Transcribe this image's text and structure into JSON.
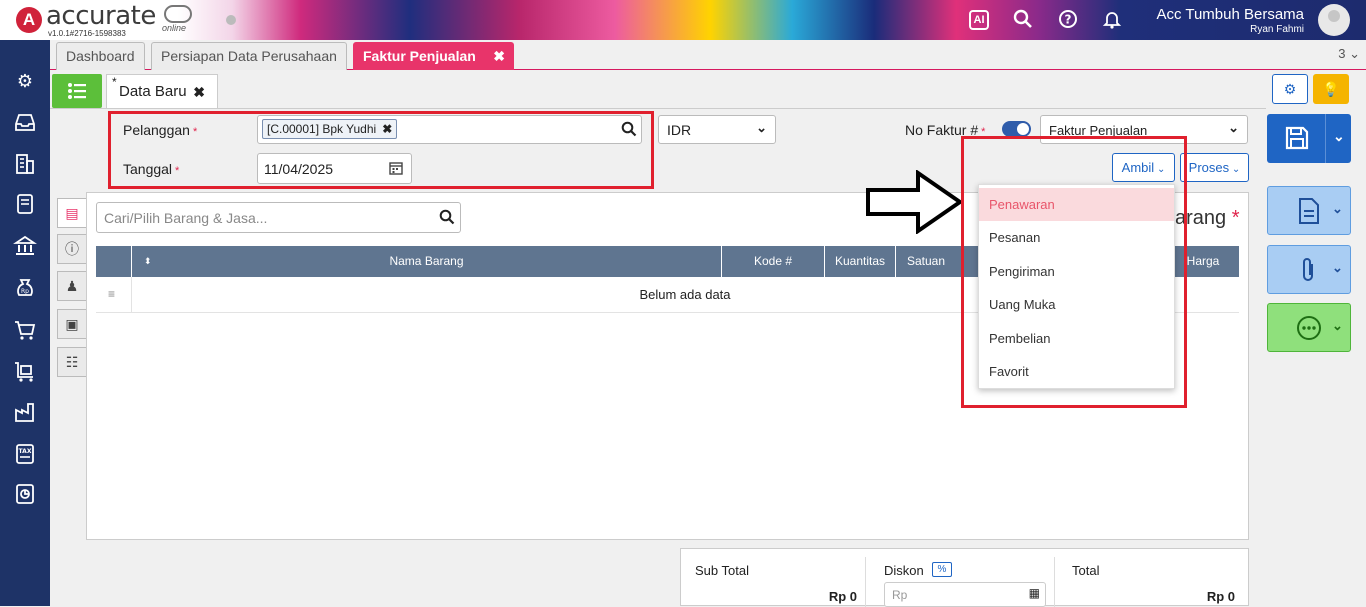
{
  "app": {
    "logo_text": "accurate",
    "logo_sub": "online",
    "version": "v1.0.1#2716-1598383",
    "company": "Acc Tumbuh Bersama",
    "user": "Ryan Fahmi"
  },
  "header_icons": [
    "ai-chip-icon",
    "search-icon",
    "help-icon",
    "bell-icon"
  ],
  "tabs": [
    {
      "label": "Dashboard"
    },
    {
      "label": "Persiapan Data Perusahaan"
    },
    {
      "label": "Faktur Penjualan",
      "close": "✖"
    }
  ],
  "tab_count": "3 ⌄",
  "subtab": {
    "label": "Data Baru",
    "modified": "*",
    "close": "✖"
  },
  "form": {
    "pelanggan_label": "Pelanggan",
    "pelanggan_value": "[C.00001] Bpk Yudhi",
    "tanggal_label": "Tanggal",
    "tanggal_value": "11/04/2025",
    "required_mark": "*",
    "currency": "IDR",
    "no_faktur_label": "No Faktur #",
    "faktur_type": "Faktur Penjualan",
    "ambil_label": "Ambil",
    "proses_label": "Proses"
  },
  "items": {
    "search_placeholder": "Cari/Pilih Barang & Jasa...",
    "title_fragment": "arang",
    "columns": [
      "Nama Barang",
      "Kode #",
      "Kuantitas",
      "Satuan",
      "Harga"
    ],
    "empty_text": "Belum ada data"
  },
  "ambil_menu": {
    "items": [
      "Penawaran",
      "Pesanan",
      "Pengiriman",
      "Uang Muka",
      "Pembelian",
      "Favorit"
    ],
    "selected": "Penawaran"
  },
  "totals": {
    "subtotal_label": "Sub Total",
    "subtotal_value": "Rp 0",
    "diskon_label": "Diskon",
    "diskon_unit": "%",
    "diskon_placeholder": "Rp",
    "total_label": "Total",
    "total_value": "Rp 0"
  },
  "colors": {
    "sidebar": "#1e3367",
    "accent_tab": "#e8346a",
    "save_button": "#1f65c4",
    "highlight_box": "#e0202e"
  }
}
